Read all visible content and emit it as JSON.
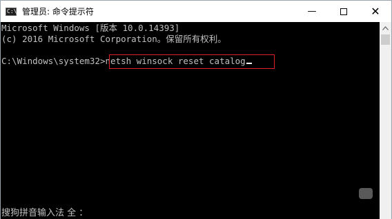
{
  "window": {
    "title": "管理员: 命令提示符",
    "app_icon_text": "C:\\",
    "minimize_glyph": "—",
    "close_glyph": "✕"
  },
  "console": {
    "lines": [
      "Microsoft Windows [版本 10.0.14393]",
      "(c) 2016 Microsoft Corporation。保留所有权利。",
      "C:\\Windows\\system32>",
      "netsh winsock reset catalog"
    ],
    "ime_status": "搜狗拼音输入法 全 ："
  },
  "colors": {
    "highlight_border": "#e0202a",
    "console_bg": "#000000",
    "console_text": "#c0c0c0"
  },
  "icons": {
    "app": "cmd-icon",
    "minimize": "minimize-icon",
    "maximize": "maximize-icon",
    "close": "close-icon",
    "scroll_up": "chevron-up-icon"
  }
}
